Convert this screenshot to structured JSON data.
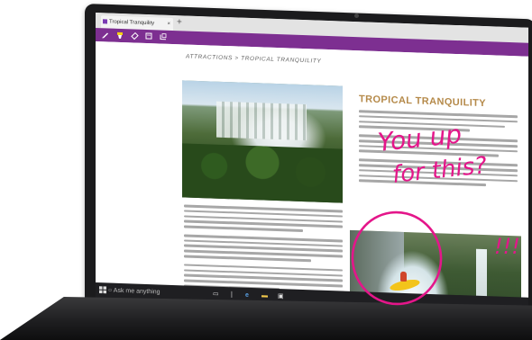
{
  "browser": {
    "tab_title": "Tropical Tranquility",
    "tab_close": "×",
    "new_tab": "+",
    "toolbar_icons": [
      "pen-icon",
      "highlighter-icon",
      "eraser-icon",
      "note-icon",
      "clip-icon"
    ]
  },
  "article": {
    "breadcrumb": "ATTRACTIONS > TROPICAL TRANQUILITY",
    "title": "TROPICAL TRANQUILITY"
  },
  "ink": {
    "note_line1": "You up",
    "note_line2": "for this?",
    "exclaim": "!!!",
    "color": "#e4168a"
  },
  "taskbar": {
    "search_placeholder": "Ask me anything"
  },
  "colors": {
    "toolbar": "#7d2f91",
    "title": "#b58a4a",
    "taskbar": "#1f1f22"
  }
}
